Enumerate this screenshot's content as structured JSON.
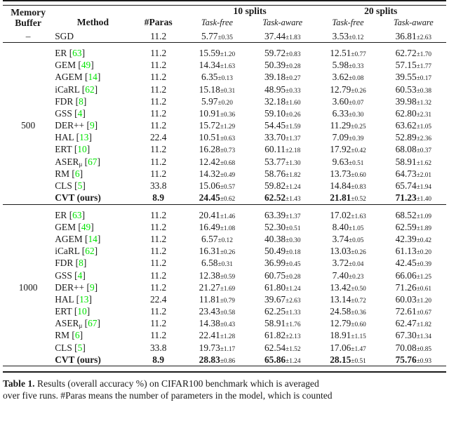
{
  "table": {
    "headers": {
      "buffer_line1": "Memory",
      "buffer_line2": "Buffer",
      "method": "Method",
      "paras": "#Paras",
      "group_10": "10 splits",
      "group_20": "20 splits",
      "sub_taskfree_10": "Task-free",
      "sub_taskaware_10": "Task-aware",
      "sub_taskfree_20": "Task-free",
      "sub_taskaware_20": "Task-aware"
    },
    "colors": {
      "citation_green": "#00e400",
      "rule": "#1a1a1a",
      "text": "#1a1a1a"
    },
    "sections": [
      {
        "buffer": "–",
        "rows": [
          {
            "method": "SGD",
            "cite": "",
            "paras": "11.2",
            "tf10": "5.77",
            "tf10_sd": "0.35",
            "ta10": "37.44",
            "ta10_sd": "1.83",
            "tf20": "3.53",
            "tf20_sd": "0.12",
            "ta20": "36.81",
            "ta20_sd": "2.63",
            "bold": false
          }
        ]
      },
      {
        "buffer": "500",
        "rows": [
          {
            "method": "ER",
            "cite": "63",
            "paras": "11.2",
            "tf10": "15.59",
            "tf10_sd": "1.20",
            "ta10": "59.72",
            "ta10_sd": "0.83",
            "tf20": "12.51",
            "tf20_sd": "0.77",
            "ta20": "62.72",
            "ta20_sd": "1.70",
            "bold": false
          },
          {
            "method": "GEM",
            "cite": "49",
            "paras": "11.2",
            "tf10": "14.34",
            "tf10_sd": "1.63",
            "ta10": "50.39",
            "ta10_sd": "0.28",
            "tf20": "5.98",
            "tf20_sd": "0.33",
            "ta20": "57.15",
            "ta20_sd": "1.77",
            "bold": false
          },
          {
            "method": "AGEM",
            "cite": "14",
            "paras": "11.2",
            "tf10": "6.35",
            "tf10_sd": "0.13",
            "ta10": "39.18",
            "ta10_sd": "0.27",
            "tf20": "3.62",
            "tf20_sd": "0.08",
            "ta20": "39.55",
            "ta20_sd": "0.17",
            "bold": false
          },
          {
            "method": "iCaRL",
            "cite": "62",
            "paras": "11.2",
            "tf10": "15.18",
            "tf10_sd": "0.31",
            "ta10": "48.95",
            "ta10_sd": "0.33",
            "tf20": "12.79",
            "tf20_sd": "0.26",
            "ta20": "60.53",
            "ta20_sd": "0.38",
            "bold": false
          },
          {
            "method": "FDR",
            "cite": "8",
            "paras": "11.2",
            "tf10": "5.97",
            "tf10_sd": "0.20",
            "ta10": "32.18",
            "ta10_sd": "1.60",
            "tf20": "3.60",
            "tf20_sd": "0.07",
            "ta20": "39.98",
            "ta20_sd": "1.32",
            "bold": false
          },
          {
            "method": "GSS",
            "cite": "4",
            "paras": "11.2",
            "tf10": "10.91",
            "tf10_sd": "0.36",
            "ta10": "59.10",
            "ta10_sd": "0.26",
            "tf20": "6.33",
            "tf20_sd": "0.30",
            "ta20": "62.80",
            "ta20_sd": "2.31",
            "bold": false
          },
          {
            "method": "DER++",
            "cite": "9",
            "paras": "11.2",
            "tf10": "15.72",
            "tf10_sd": "1.29",
            "ta10": "54.45",
            "ta10_sd": "1.59",
            "tf20": "11.29",
            "tf20_sd": "0.25",
            "ta20": "63.62",
            "ta20_sd": "1.05",
            "bold": false
          },
          {
            "method": "HAL",
            "cite": "13",
            "paras": "22.4",
            "tf10": "10.51",
            "tf10_sd": "0.63",
            "ta10": "33.70",
            "ta10_sd": "1.37",
            "tf20": "7.09",
            "tf20_sd": "0.39",
            "ta20": "52.89",
            "ta20_sd": "2.36",
            "bold": false
          },
          {
            "method": "ERT",
            "cite": "10",
            "paras": "11.2",
            "tf10": "16.28",
            "tf10_sd": "0.73",
            "ta10": "60.11",
            "ta10_sd": "2.18",
            "tf20": "17.92",
            "tf20_sd": "0.42",
            "ta20": "68.08",
            "ta20_sd": "0.37",
            "bold": false
          },
          {
            "method": "ASER",
            "method_sub": "μ",
            "cite": "67",
            "paras": "11.2",
            "tf10": "12.42",
            "tf10_sd": "0.68",
            "ta10": "53.77",
            "ta10_sd": "1.30",
            "tf20": "9.63",
            "tf20_sd": "0.51",
            "ta20": "58.91",
            "ta20_sd": "1.62",
            "bold": false
          },
          {
            "method": "RM",
            "cite": "6",
            "paras": "11.2",
            "tf10": "14.32",
            "tf10_sd": "0.49",
            "ta10": "58.76",
            "ta10_sd": "1.82",
            "tf20": "13.73",
            "tf20_sd": "0.60",
            "ta20": "64.73",
            "ta20_sd": "2.01",
            "bold": false
          },
          {
            "method": "CLS",
            "cite": "5",
            "paras": "33.8",
            "tf10": "15.06",
            "tf10_sd": "0.57",
            "ta10": "59.82",
            "ta10_sd": "1.24",
            "tf20": "14.84",
            "tf20_sd": "0.83",
            "ta20": "65.74",
            "ta20_sd": "1.94",
            "bold": false
          },
          {
            "method": "CVT (ours)",
            "cite": "",
            "paras": "8.9",
            "tf10": "24.45",
            "tf10_sd": "0.62",
            "ta10": "62.52",
            "ta10_sd": "1.43",
            "tf20": "21.81",
            "tf20_sd": "0.52",
            "ta20": "71.23",
            "ta20_sd": "1.40",
            "bold": true
          }
        ]
      },
      {
        "buffer": "1000",
        "rows": [
          {
            "method": "ER",
            "cite": "63",
            "paras": "11.2",
            "tf10": "20.41",
            "tf10_sd": "1.46",
            "ta10": "63.39",
            "ta10_sd": "1.37",
            "tf20": "17.02",
            "tf20_sd": "1.63",
            "ta20": "68.52",
            "ta20_sd": "1.09",
            "bold": false
          },
          {
            "method": "GEM",
            "cite": "49",
            "paras": "11.2",
            "tf10": "16.49",
            "tf10_sd": "1.08",
            "ta10": "52.30",
            "ta10_sd": "0.51",
            "tf20": "8.40",
            "tf20_sd": "1.05",
            "ta20": "62.59",
            "ta20_sd": "1.89",
            "bold": false
          },
          {
            "method": "AGEM",
            "cite": "14",
            "paras": "11.2",
            "tf10": "6.57",
            "tf10_sd": "0.12",
            "ta10": "40.38",
            "ta10_sd": "0.30",
            "tf20": "3.74",
            "tf20_sd": "0.05",
            "ta20": "42.39",
            "ta20_sd": "0.42",
            "bold": false
          },
          {
            "method": "iCaRL",
            "cite": "62",
            "paras": "11.2",
            "tf10": "16.31",
            "tf10_sd": "0.26",
            "ta10": "50.49",
            "ta10_sd": "0.18",
            "tf20": "13.03",
            "tf20_sd": "0.26",
            "ta20": "61.13",
            "ta20_sd": "0.20",
            "bold": false
          },
          {
            "method": "FDR",
            "cite": "8",
            "paras": "11.2",
            "tf10": "6.58",
            "tf10_sd": "0.31",
            "ta10": "36.99",
            "ta10_sd": "0.45",
            "tf20": "3.72",
            "tf20_sd": "0.04",
            "ta20": "42.45",
            "ta20_sd": "0.39",
            "bold": false
          },
          {
            "method": "GSS",
            "cite": "4",
            "paras": "11.2",
            "tf10": "12.38",
            "tf10_sd": "0.59",
            "ta10": "60.75",
            "ta10_sd": "0.28",
            "tf20": "7.40",
            "tf20_sd": "0.23",
            "ta20": "66.06",
            "ta20_sd": "1.25",
            "bold": false
          },
          {
            "method": "DER++",
            "cite": "9",
            "paras": "11.2",
            "tf10": "21.27",
            "tf10_sd": "1.69",
            "ta10": "61.80",
            "ta10_sd": "1.24",
            "tf20": "13.42",
            "tf20_sd": "0.50",
            "ta20": "71.26",
            "ta20_sd": "0.61",
            "bold": false
          },
          {
            "method": "HAL",
            "cite": "13",
            "paras": "22.4",
            "tf10": "11.81",
            "tf10_sd": "0.79",
            "ta10": "39.67",
            "ta10_sd": "2.63",
            "tf20": "13.14",
            "tf20_sd": "0.72",
            "ta20": "60.03",
            "ta20_sd": "1.20",
            "bold": false
          },
          {
            "method": "ERT",
            "cite": "10",
            "paras": "11.2",
            "tf10": "23.43",
            "tf10_sd": "0.58",
            "ta10": "62.25",
            "ta10_sd": "1.33",
            "tf20": "24.58",
            "tf20_sd": "0.36",
            "ta20": "72.61",
            "ta20_sd": "0.67",
            "bold": false
          },
          {
            "method": "ASER",
            "method_sub": "μ",
            "cite": "67",
            "paras": "11.2",
            "tf10": "14.38",
            "tf10_sd": "0.43",
            "ta10": "58.91",
            "ta10_sd": "1.76",
            "tf20": "12.79",
            "tf20_sd": "0.60",
            "ta20": "62.47",
            "ta20_sd": "1.82",
            "bold": false
          },
          {
            "method": "RM",
            "cite": "6",
            "paras": "11.2",
            "tf10": "22.41",
            "tf10_sd": "1.28",
            "ta10": "61.82",
            "ta10_sd": "2.13",
            "tf20": "18.91",
            "tf20_sd": "1.15",
            "ta20": "67.30",
            "ta20_sd": "1.34",
            "bold": false
          },
          {
            "method": "CLS",
            "cite": "5",
            "paras": "33.8",
            "tf10": "19.73",
            "tf10_sd": "1.17",
            "ta10": "62.54",
            "ta10_sd": "1.52",
            "tf20": "17.06",
            "tf20_sd": "1.47",
            "ta20": "70.08",
            "ta20_sd": "0.85",
            "bold": false
          },
          {
            "method": "CVT (ours)",
            "cite": "",
            "paras": "8.9",
            "tf10": "28.83",
            "tf10_sd": "0.86",
            "ta10": "65.86",
            "ta10_sd": "1.24",
            "tf20": "28.15",
            "tf20_sd": "0.51",
            "ta20": "75.76",
            "ta20_sd": "0.93",
            "bold": true
          }
        ]
      }
    ]
  },
  "caption": {
    "label": "Table 1.",
    "line1": "Results (overall accuracy %) on CIFAR100 benchmark which is averaged",
    "line2": "over five runs. #Paras means the number of parameters in the model, which is counted"
  }
}
